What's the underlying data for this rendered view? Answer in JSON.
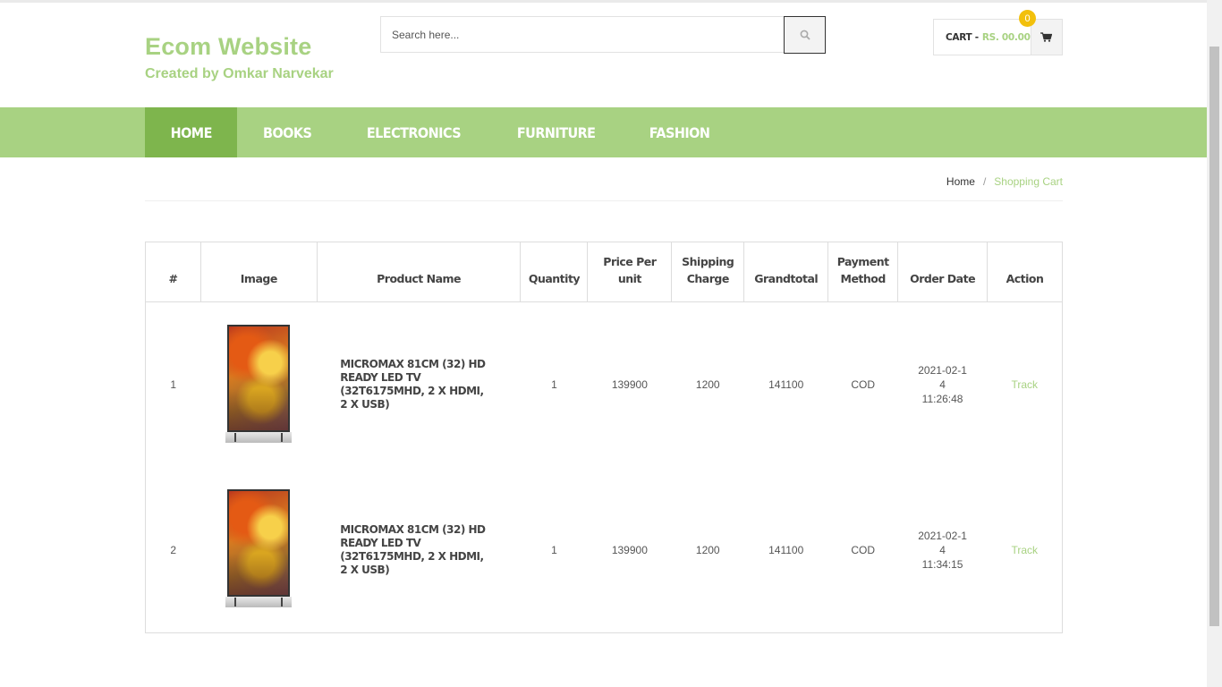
{
  "brand": {
    "title": "Ecom Website",
    "subtitle": "Created by Omkar Narvekar"
  },
  "search": {
    "placeholder": "Search here...",
    "icon": "search-icon"
  },
  "cart": {
    "label": "CART -",
    "amount": "RS. 00.00",
    "count": "0",
    "icon": "cart-icon"
  },
  "nav": {
    "items": [
      {
        "label": "HOME",
        "active": true
      },
      {
        "label": "BOOKS",
        "active": false
      },
      {
        "label": "ELECTRONICS",
        "active": false
      },
      {
        "label": "FURNITURE",
        "active": false
      },
      {
        "label": "FASHION",
        "active": false
      }
    ]
  },
  "breadcrumb": {
    "home": "Home",
    "separator": "/",
    "current": "Shopping Cart"
  },
  "table": {
    "headers": [
      "#",
      "Image",
      "Product Name",
      "Quantity",
      "Price Per unit",
      "Shipping Charge",
      "Grandtotal",
      "Payment Method",
      "Order Date",
      "Action"
    ],
    "rows": [
      {
        "index": "1",
        "product": "MICROMAX 81CM (32) HD READY LED TV (32T6175MHD, 2 X HDMI, 2 X USB)",
        "quantity": "1",
        "price": "139900",
        "shipping": "1200",
        "grandtotal": "141100",
        "payment": "COD",
        "date": "2021-02-14",
        "time": "11:26:48",
        "action": "Track"
      },
      {
        "index": "2",
        "product": "MICROMAX 81CM (32) HD READY LED TV (32T6175MHD, 2 X HDMI, 2 X USB)",
        "quantity": "1",
        "price": "139900",
        "shipping": "1200",
        "grandtotal": "141100",
        "payment": "COD",
        "date": "2021-02-14",
        "time": "11:34:15",
        "action": "Track"
      }
    ]
  },
  "colors": {
    "accent": "#a8d282",
    "nav_active": "#7eb54d",
    "badge": "#f2c00c"
  }
}
